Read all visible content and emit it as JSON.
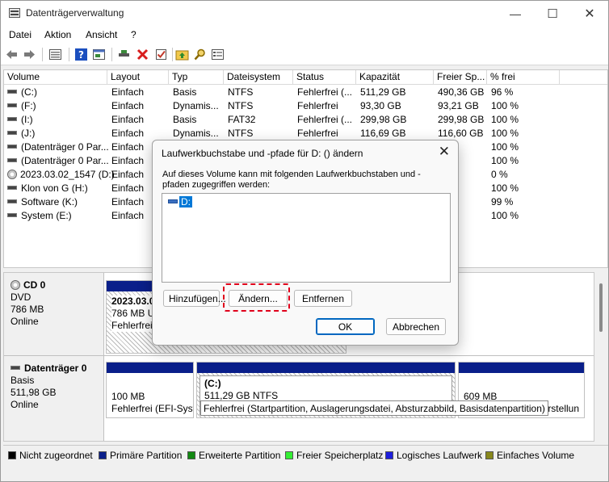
{
  "window": {
    "title": "Datenträgerverwaltung"
  },
  "menu": [
    "Datei",
    "Aktion",
    "Ansicht",
    "?"
  ],
  "columns": [
    "Volume",
    "Layout",
    "Typ",
    "Dateisystem",
    "Status",
    "Kapazität",
    "Freier Sp...",
    "% frei"
  ],
  "rows": [
    {
      "volume": "(C:)",
      "layout": "Einfach",
      "typ": "Basis",
      "fs": "NTFS",
      "status": "Fehlerfrei (...",
      "cap": "511,29 GB",
      "free": "490,36 GB",
      "pct": "96 %"
    },
    {
      "volume": "(F:)",
      "layout": "Einfach",
      "typ": "Dynamis...",
      "fs": "NTFS",
      "status": "Fehlerfrei",
      "cap": "93,30 GB",
      "free": "93,21 GB",
      "pct": "100 %"
    },
    {
      "volume": "(I:)",
      "layout": "Einfach",
      "typ": "Basis",
      "fs": "FAT32",
      "status": "Fehlerfrei (...",
      "cap": "299,98 GB",
      "free": "299,98 GB",
      "pct": "100 %"
    },
    {
      "volume": "(J:)",
      "layout": "Einfach",
      "typ": "Dynamis...",
      "fs": "NTFS",
      "status": "Fehlerfrei",
      "cap": "116,69 GB",
      "free": "116,60 GB",
      "pct": "100 %"
    },
    {
      "volume": "(Datenträger 0 Par...",
      "layout": "Einfach",
      "typ": "",
      "fs": "",
      "status": "",
      "cap": "",
      "free": "MB",
      "pct": "100 %"
    },
    {
      "volume": "(Datenträger 0 Par...",
      "layout": "Einfach",
      "typ": "",
      "fs": "",
      "status": "",
      "cap": "",
      "free": "MB",
      "pct": "100 %"
    },
    {
      "volume": "2023.03.02_1547 (D:)",
      "layout": "Einfach",
      "typ": "",
      "fs": "",
      "status": "",
      "cap": "",
      "free": "3",
      "pct": "0 %"
    },
    {
      "volume": "Klon von G (H:)",
      "layout": "Einfach",
      "typ": "",
      "fs": "",
      "status": "",
      "cap": "",
      "free": "GB",
      "pct": "100 %"
    },
    {
      "volume": "Software (K:)",
      "layout": "Einfach",
      "typ": "",
      "fs": "",
      "status": "",
      "cap": "",
      "free": "GB",
      "pct": "99 %"
    },
    {
      "volume": "System (E:)",
      "layout": "Einfach",
      "typ": "",
      "fs": "",
      "status": "",
      "cap": "",
      "free": "GB",
      "pct": "100 %"
    }
  ],
  "disks": {
    "cd0": {
      "name": "CD 0",
      "type": "DVD",
      "size": "786 MB",
      "state": "Online",
      "part": {
        "name": "2023.03.0",
        "size": "786 MB UI",
        "status": "Fehlerfrei"
      }
    },
    "disk0": {
      "name": "Datenträger 0",
      "type": "Basis",
      "size": "511,98 GB",
      "state": "Online",
      "p1": {
        "size": "100 MB",
        "status": "Fehlerfrei (EFI-Syst"
      },
      "p2": {
        "name": "(C:)",
        "size": "511,29 GB NTFS"
      },
      "p3": {
        "size": "609 MB",
        "status": "erstellun"
      }
    }
  },
  "tooltip": "Fehlerfrei (Startpartition, Auslagerungsdatei, Absturzabbild, Basisdatenpartition)",
  "legend": [
    {
      "label": "Nicht zugeordnet",
      "color": "#000000"
    },
    {
      "label": "Primäre Partition",
      "color": "#0a1f8a"
    },
    {
      "label": "Erweiterte Partition",
      "color": "#118811"
    },
    {
      "label": "Freier Speicherplatz",
      "color": "#33ee33"
    },
    {
      "label": "Logisches Laufwerk",
      "color": "#1f1fdd"
    },
    {
      "label": "Einfaches Volume",
      "color": "#88881c"
    }
  ],
  "dialog": {
    "title": "Laufwerkbuchstabe und -pfade für D: () ändern",
    "description": "Auf dieses Volume kann mit folgenden Laufwerkbuchstaben und -pfaden zugegriffen werden:",
    "item": "D:",
    "add": "Hinzufügen...",
    "change": "Ändern...",
    "remove": "Entfernen",
    "ok": "OK",
    "cancel": "Abbrechen"
  }
}
